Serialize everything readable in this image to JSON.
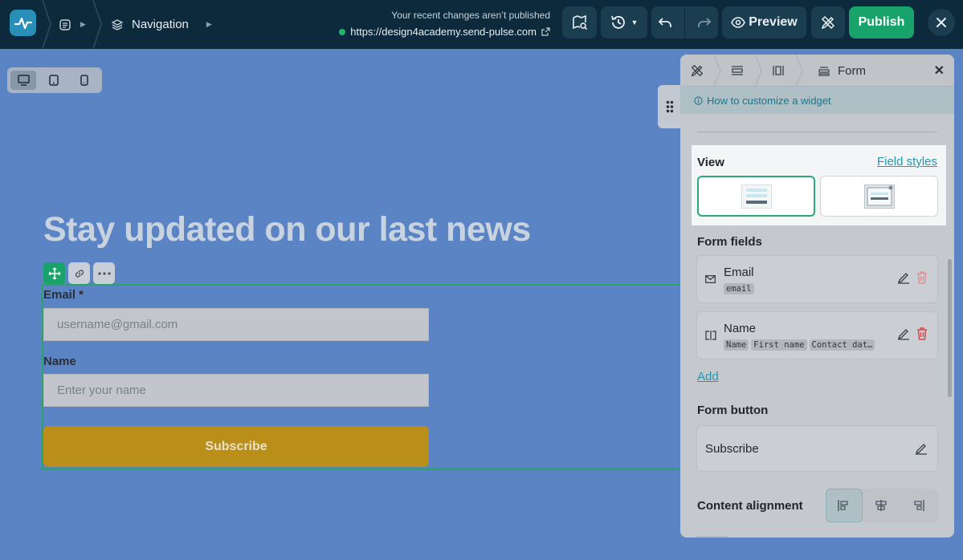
{
  "topbar": {
    "breadcrumb_label": "Navigation",
    "publish_note": "Your recent changes aren’t published",
    "site_url": "https://design4academy.send-pulse.com",
    "preview_label": "Preview",
    "publish_label": "Publish"
  },
  "canvas": {
    "headline": "Stay updated on our last news",
    "email_label": "Email *",
    "email_placeholder": "username@gmail.com",
    "name_label": "Name",
    "name_placeholder": "Enter your name",
    "button_label": "Subscribe"
  },
  "panel": {
    "title": "Form",
    "help_link": "How to customize a widget",
    "view_title": "View",
    "field_styles_link": "Field styles",
    "form_fields_title": "Form fields",
    "fields": [
      {
        "name": "Email",
        "tags": [
          "email"
        ]
      },
      {
        "name": "Name",
        "tags": [
          "Name",
          "First name",
          "Contact dat…"
        ]
      }
    ],
    "add_link": "Add",
    "form_button_title": "Form button",
    "form_button_label": "Subscribe",
    "content_alignment_title": "Content alignment"
  },
  "colors": {
    "topbar": "#0d2a3c",
    "publish": "#17a36a",
    "canvas": "#5a84c4",
    "subscribe_button": "#b98f1a",
    "link": "#2299b2",
    "delete": "#d9444b"
  }
}
